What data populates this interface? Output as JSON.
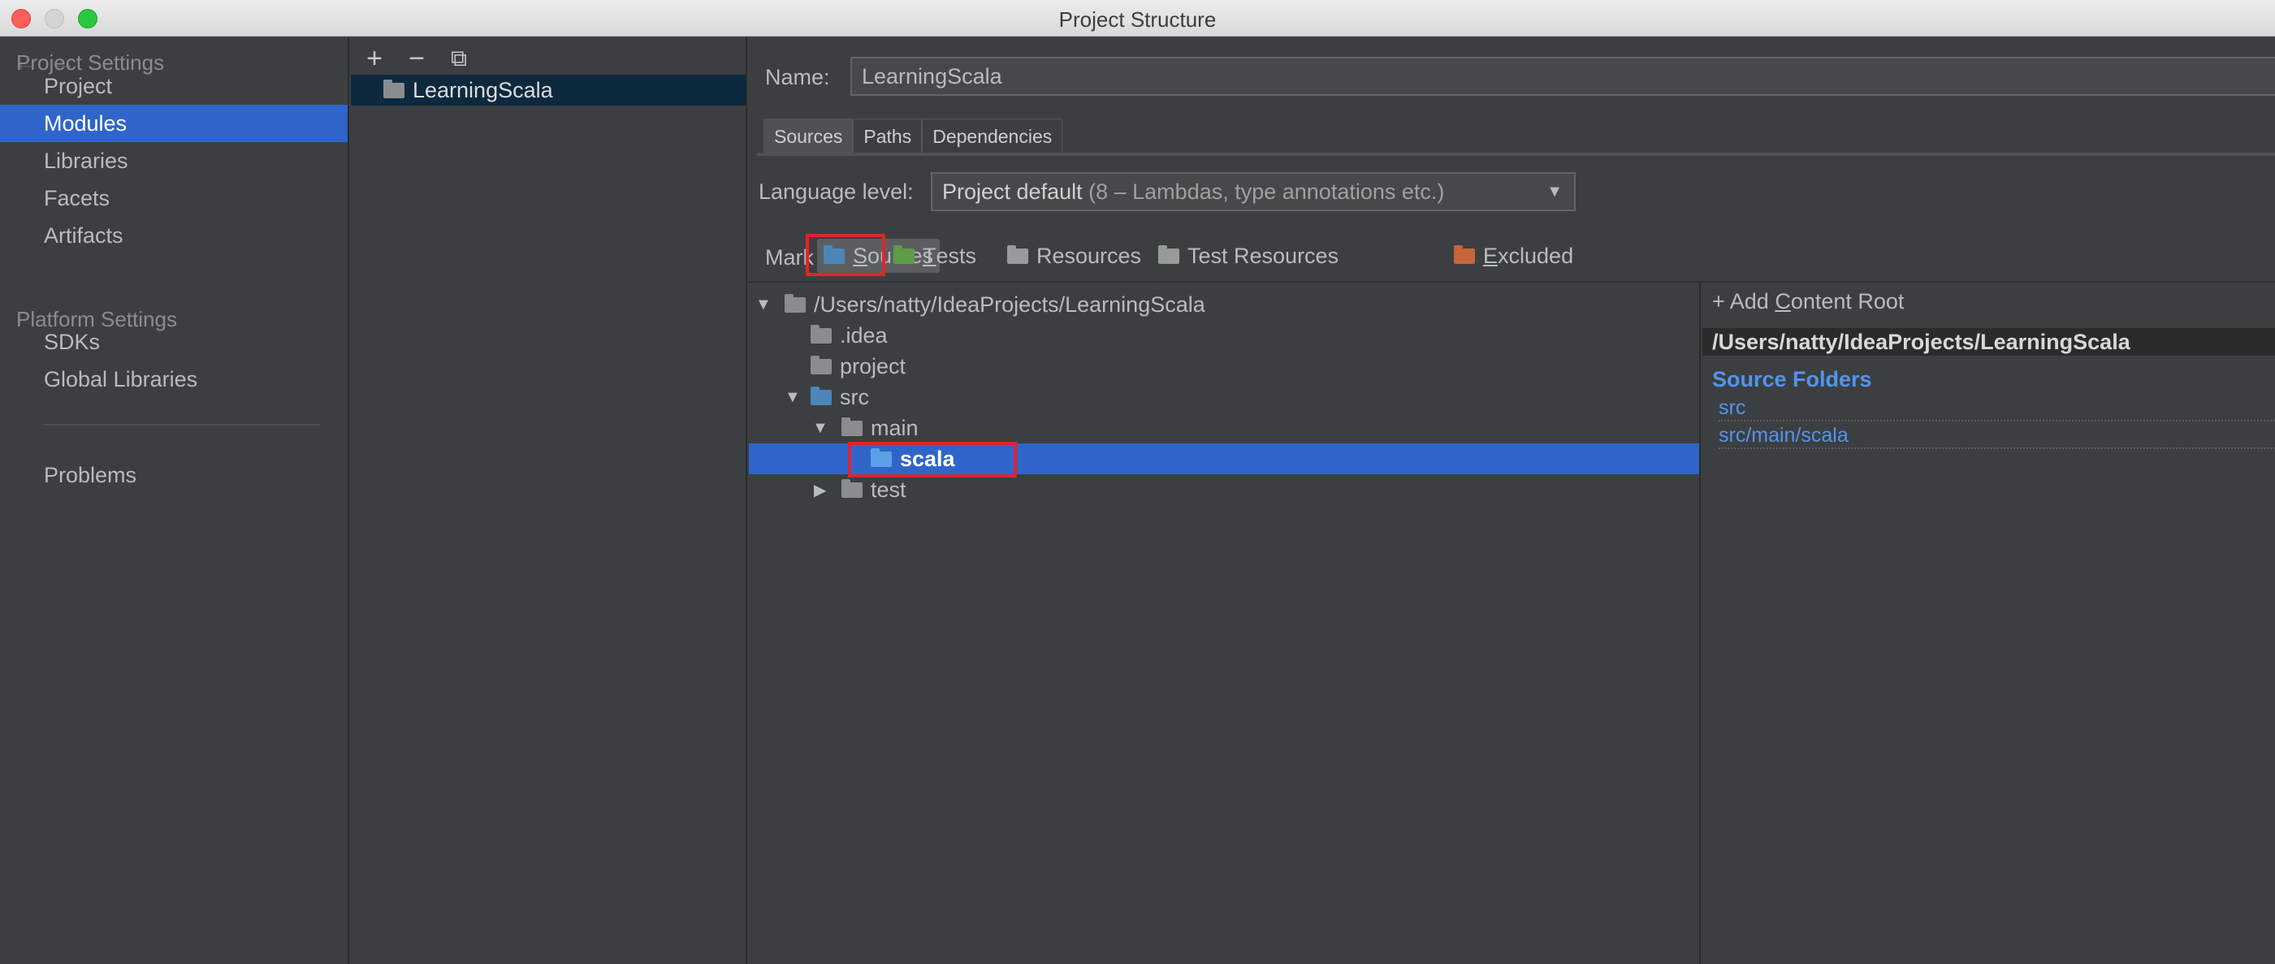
{
  "window": {
    "title": "Project Structure"
  },
  "sidebar": {
    "back_icon": "arrow-left",
    "forward_icon": "arrow-right",
    "project_settings_heading": "Project Settings",
    "project_settings_items": [
      "Project",
      "Modules",
      "Libraries",
      "Facets",
      "Artifacts"
    ],
    "platform_settings_heading": "Platform Settings",
    "platform_settings_items": [
      "SDKs",
      "Global Libraries"
    ],
    "problems_label": "Problems",
    "selected": "Modules"
  },
  "modules": {
    "toolbar_icons": [
      "add-icon",
      "remove-icon",
      "copy-icon"
    ],
    "toolbar_glyphs": [
      "+",
      "−",
      "⧉"
    ],
    "items": [
      "LearningScala"
    ]
  },
  "module": {
    "name_label": "Name:",
    "name_value": "LearningScala",
    "tabs": [
      "Sources",
      "Paths",
      "Dependencies"
    ],
    "active_tab": "Sources",
    "language_level_label": "Language level:",
    "language_level_value": "Project default",
    "language_level_detail": "(8 – Lambdas, type annotations etc.)",
    "mark_as_label": "Mark as:",
    "mark_as_buttons": [
      {
        "label": "Sources",
        "mnemonic": "S",
        "rest": "ources",
        "color": "#4a87b8"
      },
      {
        "label": "Tests",
        "mnemonic": "T",
        "rest": "ests",
        "color": "#5f9c46"
      },
      {
        "label": "Resources",
        "mnemonic": "",
        "rest": "Resources",
        "color": "#9a9a9a"
      },
      {
        "label": "Test Resources",
        "mnemonic": "",
        "rest": "Test Resources",
        "color": "#9a9a9a"
      },
      {
        "label": "Excluded",
        "mnemonic": "E",
        "rest": "xcluded",
        "color": "#c8643b"
      }
    ]
  },
  "tree": {
    "nodes": [
      {
        "label": "/Users/natty/IdeaProjects/LearningScala",
        "depth": 0,
        "expanded": true
      },
      {
        "label": ".idea",
        "depth": 1
      },
      {
        "label": "project",
        "depth": 1
      },
      {
        "label": "src",
        "depth": 1,
        "expanded": true
      },
      {
        "label": "main",
        "depth": 2,
        "expanded": true
      },
      {
        "label": "scala",
        "depth": 3,
        "selected": true
      },
      {
        "label": "test",
        "depth": 2,
        "expanded": false
      }
    ]
  },
  "content_root": {
    "add_label_prefix": "+ Add ",
    "add_label_mnemonic": "C",
    "add_label_rest": "ontent Root",
    "path": "/Users/natty/IdeaProjects/LearningScala",
    "source_folders_heading": "Source Folders",
    "source_folders": [
      "src",
      "src/main/scala"
    ]
  },
  "colors": {
    "selection": "#2f65ca",
    "link": "#5394ec",
    "highlight_box": "#e0242b",
    "source_folder": "#4a87b8",
    "plain_folder": "#8a8d90"
  }
}
